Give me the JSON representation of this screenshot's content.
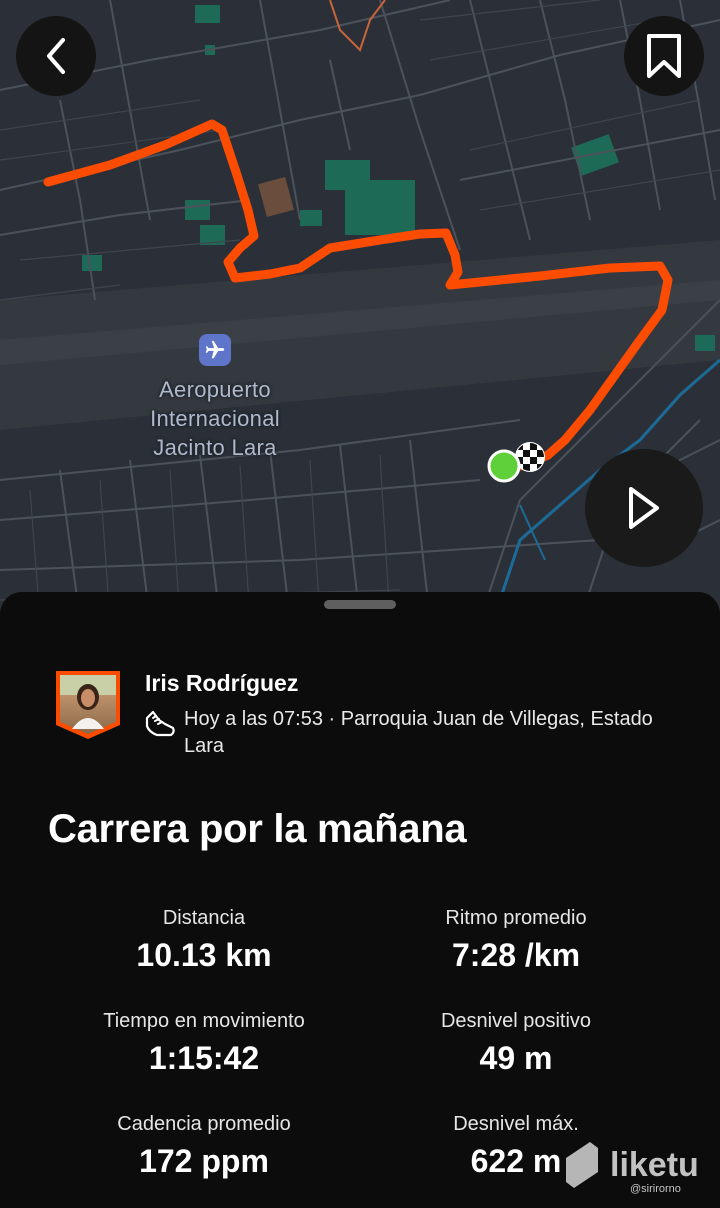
{
  "map": {
    "airport_name": "Aeropuerto\nInternacional\nJacinto Lara",
    "route_color": "#fc4c02",
    "start_marker_color": "#5fd03a"
  },
  "nav": {
    "back_icon": "chevron-left-icon",
    "bookmark_icon": "bookmark-icon",
    "play_icon": "play-icon"
  },
  "athlete": {
    "name": "Iris Rodríguez",
    "activity_meta": "Hoy a las 07:53 · Parroquia Juan de Villegas, Estado Lara"
  },
  "activity": {
    "title": "Carrera por la mañana",
    "stats": [
      {
        "label": "Distancia",
        "value": "10.13 km"
      },
      {
        "label": "Ritmo promedio",
        "value": "7:28 /km"
      },
      {
        "label": "Tiempo en movimiento",
        "value": "1:15:42"
      },
      {
        "label": "Desnivel positivo",
        "value": "49 m"
      },
      {
        "label": "Cadencia promedio",
        "value": "172 ppm"
      },
      {
        "label": "Desnivel máx.",
        "value": "622 m"
      }
    ]
  },
  "watermark": {
    "brand": "liketu",
    "handle": "@sirirorno"
  }
}
